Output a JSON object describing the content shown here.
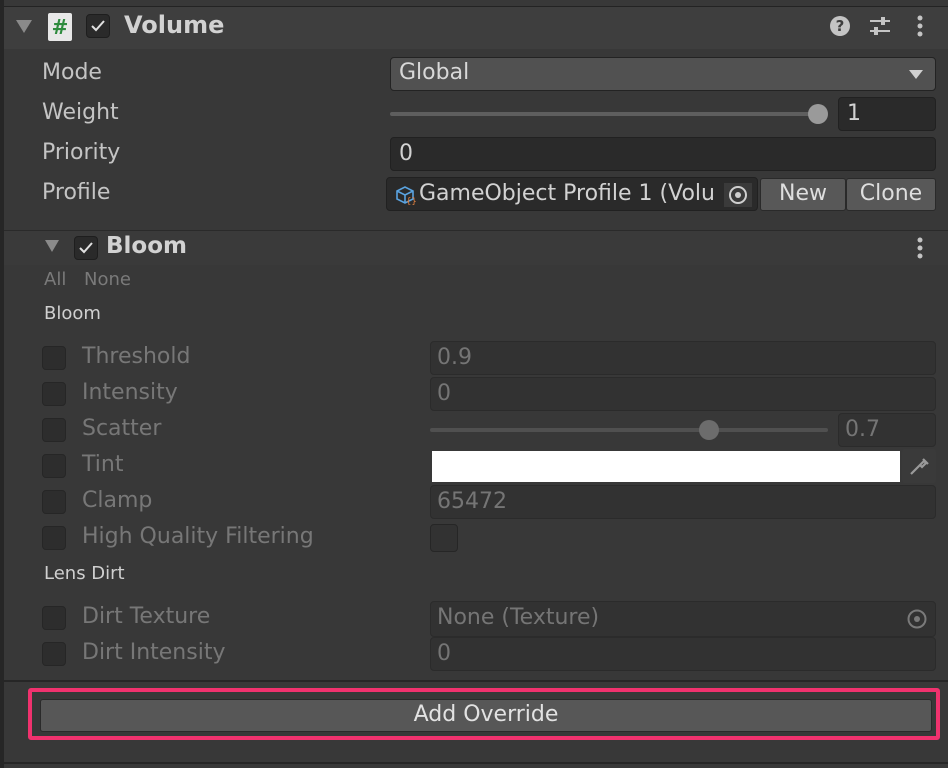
{
  "component": {
    "title": "Volume",
    "enabled": true
  },
  "fields": {
    "mode": {
      "label": "Mode",
      "value": "Global"
    },
    "weight": {
      "label": "Weight",
      "value": "1",
      "slider_fraction": 1.0
    },
    "priority": {
      "label": "Priority",
      "value": "0"
    },
    "profile": {
      "label": "Profile",
      "value": "GameObject Profile 1 (Volu",
      "new_label": "New",
      "clone_label": "Clone"
    }
  },
  "bloom": {
    "title": "Bloom",
    "enabled": true,
    "all_label": "All",
    "none_label": "None",
    "section_bloom": "Bloom",
    "threshold": {
      "label": "Threshold",
      "value": "0.9"
    },
    "intensity": {
      "label": "Intensity",
      "value": "0"
    },
    "scatter": {
      "label": "Scatter",
      "value": "0.7",
      "slider_fraction": 0.7
    },
    "tint": {
      "label": "Tint",
      "color": "#ffffff"
    },
    "clamp": {
      "label": "Clamp",
      "value": "65472"
    },
    "hq_filtering": {
      "label": "High Quality Filtering",
      "checked": false
    },
    "section_lens_dirt": "Lens Dirt",
    "dirt_texture": {
      "label": "Dirt Texture",
      "value": "None (Texture)"
    },
    "dirt_intensity": {
      "label": "Dirt Intensity",
      "value": "0"
    }
  },
  "add_override_label": "Add Override",
  "colors": {
    "highlight": "#f0326e",
    "background": "#383838"
  },
  "icons": {
    "script": "script-hash-icon",
    "help": "help-icon",
    "presets": "presets-sliders-icon",
    "menu": "kebab-menu-icon",
    "profile": "volume-profile-icon",
    "picker": "object-picker-icon",
    "eyedropper": "eyedropper-icon"
  }
}
